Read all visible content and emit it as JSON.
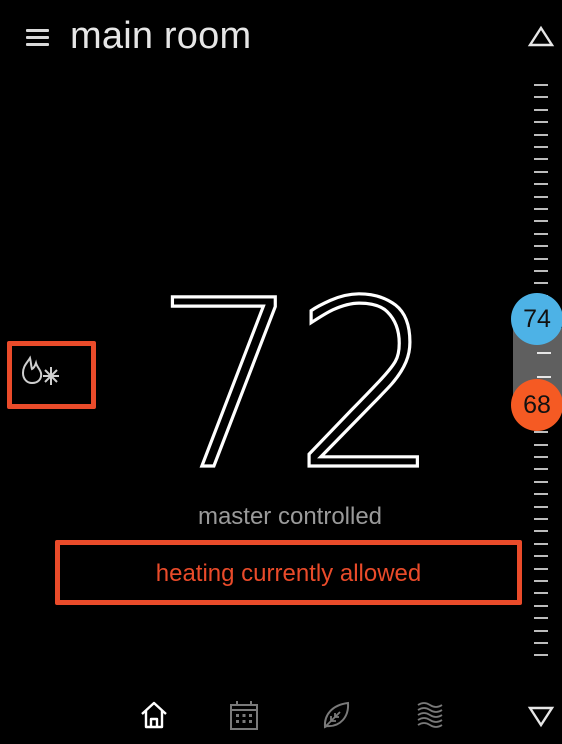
{
  "header": {
    "title": "main room",
    "menu_icon": "hamburger-menu-icon",
    "up_icon": "triangle-up-icon"
  },
  "mode": {
    "icon": "heat-cool-flame-snowflake-icon"
  },
  "current_temperature": "72",
  "control_text": "master controlled",
  "status_text": "heating currently allowed",
  "setpoints": {
    "cool": "74",
    "heat": "68"
  },
  "colors": {
    "background": "#000000",
    "highlight": "#ea4b2a",
    "cool": "#4db2e6",
    "heat": "#f55a23",
    "status_text": "#ea4b2a"
  },
  "nav": {
    "items": [
      {
        "icon": "home-icon"
      },
      {
        "icon": "calendar-icon"
      },
      {
        "icon": "leaf-icon"
      },
      {
        "icon": "fan-waves-icon"
      }
    ],
    "down_icon": "triangle-down-icon"
  }
}
